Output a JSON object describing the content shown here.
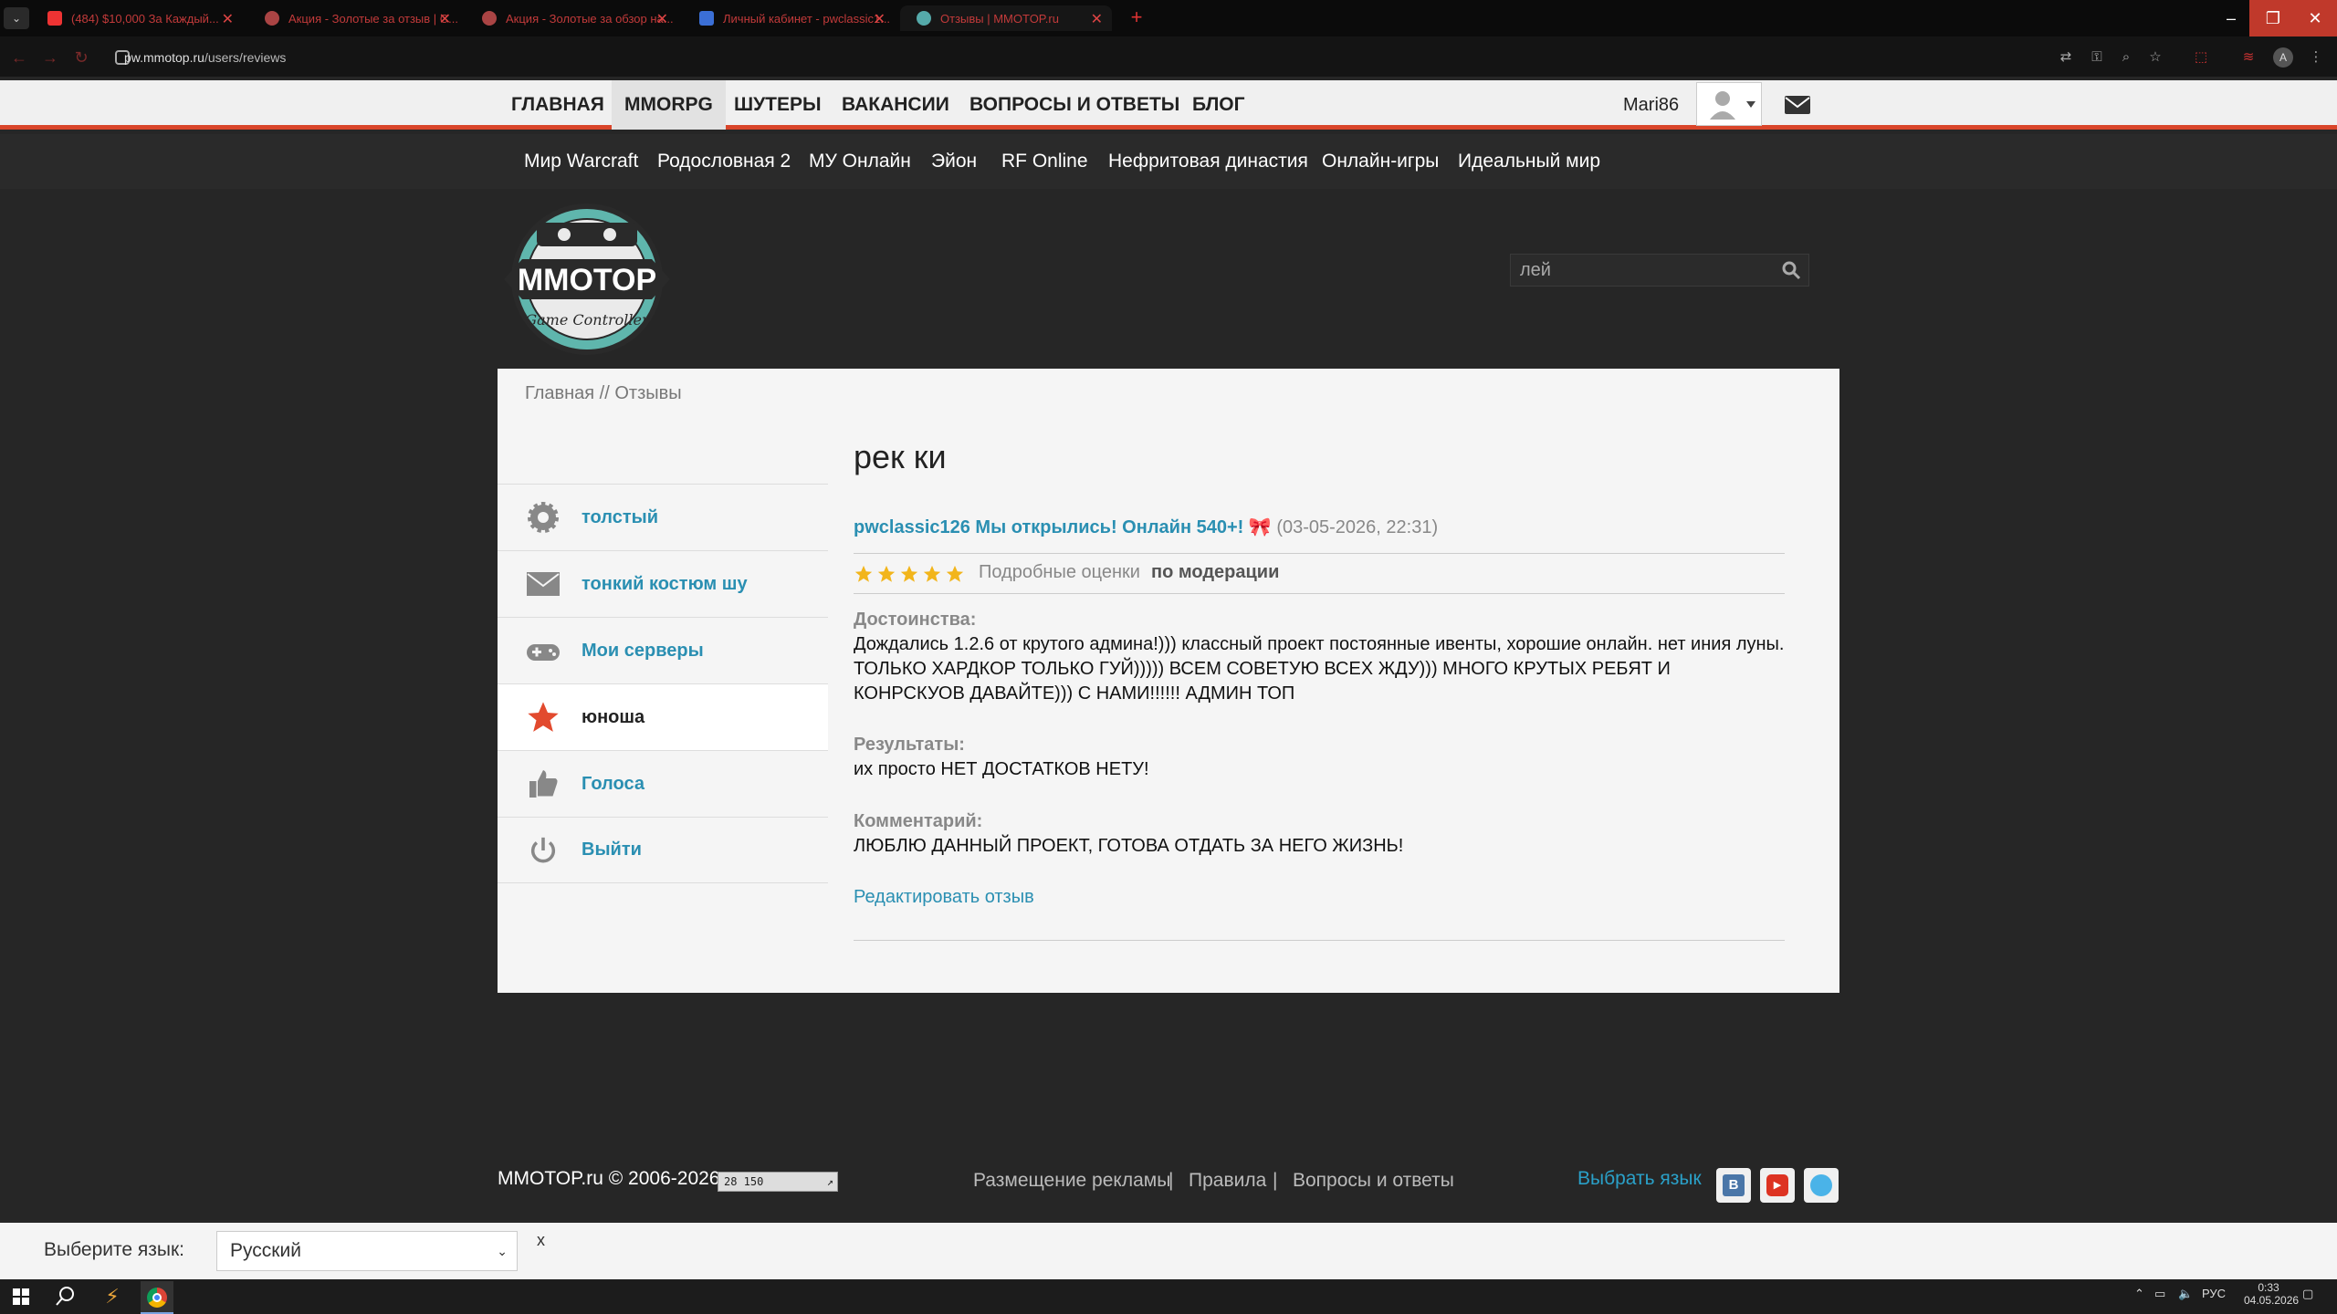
{
  "browser": {
    "tabs": [
      {
        "label": "(484) $10,000 За Каждый..."
      },
      {
        "label": "Акция - Золотые за отзыв | С..."
      },
      {
        "label": "Акция - Золотые за обзор на..."
      },
      {
        "label": "Личный кабинет - pwclassic1..."
      },
      {
        "label": "Отзывы | MMOTOP.ru"
      }
    ],
    "new_tab": "+",
    "url_host": "pw.mmotop.ru",
    "url_path": "/users/reviews"
  },
  "nav": {
    "items": [
      "ГЛАВНАЯ",
      "MMORPG",
      "ШУТЕРЫ",
      "ВАКАНСИИ",
      "ВОПРОСЫ И ОТВЕТЫ",
      "БЛОГ"
    ],
    "username": "Mari86"
  },
  "subnav": {
    "items": [
      "Мир Warcraft",
      "Родословная 2",
      "МУ Онлайн",
      "Эйон",
      "RF Online",
      "Нефритовая династия",
      "Онлайн-игры",
      "Идеальный мир"
    ]
  },
  "logo": {
    "text": "MMOTOP",
    "sub": "Game Controller"
  },
  "search": {
    "value": "лей"
  },
  "breadcrumb": "Главная // Отзывы",
  "sidebar": {
    "items": [
      {
        "label": "толстый",
        "icon": "gear-icon"
      },
      {
        "label": "тонкий костюм шу",
        "icon": "envelope-icon"
      },
      {
        "label": "Мои серверы",
        "icon": "gamepad-icon"
      },
      {
        "label": "юноша",
        "icon": "star-icon"
      },
      {
        "label": "Голоса",
        "icon": "thumbs-up-icon"
      },
      {
        "label": "Выйти",
        "icon": "power-icon"
      }
    ]
  },
  "review": {
    "page_title": "рек ки",
    "server_title": "pwclassic126 Мы открылись! Онлайн 540+!",
    "date": "(03-05-2026, 22:31)",
    "rating": 5,
    "detailed_link": "Подробные оценки",
    "status": "по модерации",
    "pros_label": "Достоинства:",
    "pros_text": "Дождались 1.2.6 от крутого админа!))) классный проект постоянные ивенты, хорошие онлайн. нет иния луны. ТОЛЬКО ХАРДКОР ТОЛЬКО ГУЙ))))) ВСЕМ СОВЕТУЮ ВСЕХ ЖДУ))) МНОГО КРУТЫХ РЕБЯТ И КОНРСКУОВ ДАВАЙТЕ))) С НАМИ!!!!!! АДМИН ТОП",
    "results_label": "Результаты:",
    "results_text": "их просто НЕТ ДОСТАТКОВ НЕТУ!",
    "comment_label": "Комментарий:",
    "comment_text": "ЛЮБЛЮ ДАННЫЙ ПРОЕКТ, ГОТОВА ОТДАТЬ ЗА НЕГО ЖИЗНЬ!",
    "edit_link": "Редактировать отзыв"
  },
  "footer": {
    "copyright": "MMOTOP.ru © 2006-2026",
    "counter": "28 150",
    "links": [
      "Размещение рекламы",
      "Правила",
      "Вопросы и ответы"
    ],
    "separator": "|",
    "choose_lang": "Выбрать язык"
  },
  "langbar": {
    "label": "Выберите язык:",
    "selected": "Русский",
    "close": "x"
  },
  "taskbar": {
    "lang": "РУС",
    "time": "0:33",
    "date": "04.05.2026"
  },
  "colors": {
    "accent": "#2a8fb2",
    "nav_underline": "#d9452a",
    "star": "#f2b51b"
  }
}
